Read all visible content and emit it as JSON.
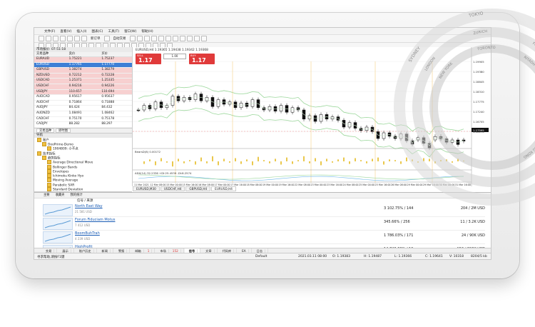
{
  "menu": [
    "文件(F)",
    "查看(V)",
    "插入(I)",
    "图表(C)",
    "工具(T)",
    "窗口(W)",
    "帮助(H)"
  ],
  "toolbar": {
    "new_order": "新订单",
    "auto_trading": "自动交易"
  },
  "market_watch": {
    "title": "市场报价: 07:51:18",
    "columns": [
      "交易品种",
      "卖价",
      "买价"
    ],
    "rows": [
      {
        "symbol": "EURAUD",
        "bid": "1.75221",
        "ask": "1.75237",
        "style": "red"
      },
      {
        "symbol": "EURUSD",
        "bid": "1.17765",
        "ask": "1.17770",
        "style": "sel"
      },
      {
        "symbol": "GBPUSD",
        "bid": "1.38274",
        "ask": "1.38279",
        "style": "red"
      },
      {
        "symbol": "NZDUSD",
        "bid": "0.72212",
        "ask": "0.72228",
        "style": "red"
      },
      {
        "symbol": "USDCAD",
        "bid": "1.25371",
        "ask": "1.25335",
        "style": "red"
      },
      {
        "symbol": "USDCHF",
        "bid": "0.94216",
        "ask": "0.94226",
        "style": "red"
      },
      {
        "symbol": "USDJPY",
        "bid": "110.657",
        "ask": "110.694",
        "style": "red"
      },
      {
        "symbol": "AUDCAD",
        "bid": "0.95617",
        "ask": "0.95637",
        "style": ""
      },
      {
        "symbol": "AUDCHF",
        "bid": "0.71864",
        "ask": "0.71888",
        "style": ""
      },
      {
        "symbol": "AUDJPY",
        "bid": "84.424",
        "ask": "84.432",
        "style": ""
      },
      {
        "symbol": "AUDNZD",
        "bid": "1.08491",
        "ask": "1.08462",
        "style": ""
      },
      {
        "symbol": "CADCHF",
        "bid": "0.75170",
        "ask": "0.75178",
        "style": ""
      },
      {
        "symbol": "CADJPY",
        "bid": "88.282",
        "ask": "88.297",
        "style": ""
      }
    ],
    "tabs": [
      "交易品种",
      "即时图"
    ]
  },
  "navigator": {
    "title": "导航",
    "items": [
      {
        "label": "账户",
        "level": 0
      },
      {
        "label": "DooPrime-Demo",
        "level": 1
      },
      {
        "label": "1904809: 小不点",
        "level": 2
      },
      {
        "label": "技术指标",
        "level": 0
      },
      {
        "label": "趋势指标",
        "level": 1
      },
      {
        "label": "Average Directional Move",
        "level": 2
      },
      {
        "label": "Bollinger Bands",
        "level": 2
      },
      {
        "label": "Envelopes",
        "level": 2
      },
      {
        "label": "Ichimoku Kinko Hyo",
        "level": 2
      },
      {
        "label": "Moving Average",
        "level": 2
      },
      {
        "label": "Parabolic SAR",
        "level": 2
      },
      {
        "label": "Standard Deviation",
        "level": 2
      }
    ],
    "tabs": [
      "常用",
      "收藏夹"
    ]
  },
  "chart": {
    "symbol_label": "EURUSD,H4 1.19365 1.19438 1.19342 1.19368",
    "sell": {
      "label": "SELL",
      "price": "1.17 70",
      "sup": "5"
    },
    "buy": {
      "label": "BUY",
      "price": "1.17 71",
      "sup": "0"
    },
    "volume": "1.00",
    "indicator1_label": "BearsD(8) 0.00172",
    "indicator2_label": "ADX(14) 32.2336 +DI:25.4539 -DI:8.2574",
    "current_price": "1.17595",
    "price_ticks": [
      "1.19905",
      "1.19380",
      "1.18845",
      "1.18310",
      "1.17775",
      "1.17240",
      "1.16705",
      "1.16170"
    ],
    "time_ticks": [
      "11 Mar 2021",
      "12 Mar 08:00",
      "15 Mar 00:00",
      "15 Mar 16:00",
      "16 Mar 08:00",
      "17 Mar 00:00",
      "17 Mar 16:00",
      "18 Mar 08:00",
      "19 Mar 00:00",
      "19 Mar 16:00",
      "22 Mar 08:00",
      "23 Mar 00:00",
      "23 Mar 16:00",
      "24 Mar 08:00",
      "25 Mar 00:00",
      "25 Mar 16:00",
      "26 Mar 08:00",
      "29 Mar 00:00",
      "29 Mar 16:00",
      "30 Mar 08:00",
      "31 Mar 16:00"
    ],
    "tabs": [
      "EURUSD,M30",
      "USDCHF,H4",
      "GBPUSD,H4",
      "EURUSD,H4"
    ]
  },
  "cities": [
    "SYDNEY",
    "TOKYO",
    "LONDON",
    "ZURICH",
    "FRANKFURT",
    "HONG KONG",
    "MOSCOW",
    "NEW YORK",
    "TORONTO",
    "WELLINGTON",
    "RIYADH",
    "CHICAGO"
  ],
  "terminal": {
    "tabs": [
      "主要",
      "收藏夹",
      "我的统计"
    ],
    "columns": [
      "信号 / 来源"
    ],
    "signals": [
      {
        "name": "North East Way",
        "sub": "21 581 USD",
        "ret": "3 102.75% / 144",
        "subs": "204 / 2M USD"
      },
      {
        "name": "Forum Fiduciam Motus",
        "sub": "7 412 USD",
        "ret": "345.66% / 256",
        "subs": "11 / 3.2K USD"
      },
      {
        "name": "BoomBuhTrah",
        "sub": "4 239 USD",
        "ret": "1 786.03% / 171",
        "subs": "24 / 90K USD"
      },
      {
        "name": "HighProfit",
        "sub": "",
        "ret": "14 743.60% / 19",
        "subs": "152 / 896K USD"
      }
    ],
    "bottom_tabs": [
      "交易",
      "展示",
      "账户历史",
      "新闻",
      "警报",
      "邮箱",
      "市场",
      "信号",
      "文章",
      "代码库",
      "EA",
      "日志"
    ],
    "badges": {
      "邮箱": "1",
      "市场": "152"
    }
  },
  "status": {
    "help": "寻求帮助,请按F1键",
    "profile": "Default",
    "datetime": "2021.03.11 08:00",
    "o": "O: 1.19383",
    "h": "H: 1.19487",
    "l": "L: 1.19366",
    "c": "C: 1.19641",
    "v": "V: 10318",
    "net": "8204/5 kb"
  },
  "colors": {
    "candle_bull": "#ffffff",
    "candle_bear": "#111111",
    "band": "#9bd79b",
    "sell": "#e03a3a",
    "buy": "#e03a3a",
    "accent": "#3d7fd6"
  }
}
